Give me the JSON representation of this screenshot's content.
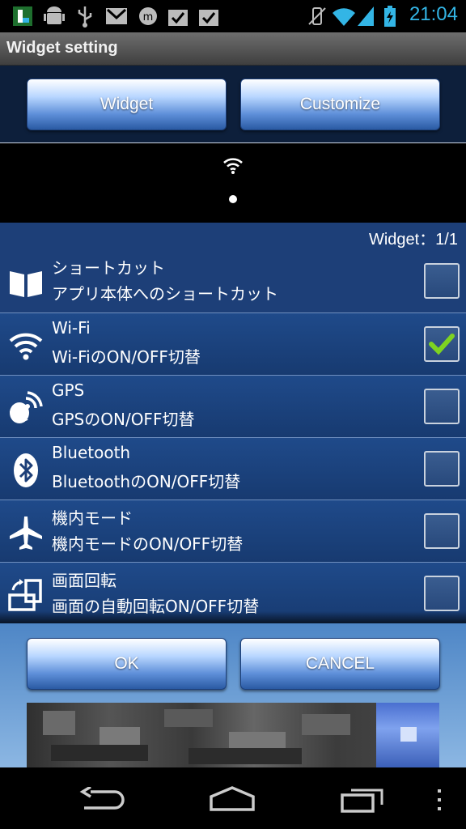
{
  "status": {
    "time": "21:04"
  },
  "title": "Widget setting",
  "tabs": {
    "widget": "Widget",
    "customize": "Customize"
  },
  "counter": "Widget：1/1",
  "items": [
    {
      "title": "ショートカット",
      "subtitle": "アプリ本体へのショートカット",
      "icon": "shortcut-icon",
      "checked": false
    },
    {
      "title": "Wi-Fi",
      "subtitle": "Wi-FiのON/OFF切替",
      "icon": "wifi-icon",
      "checked": true
    },
    {
      "title": "GPS",
      "subtitle": "GPSのON/OFF切替",
      "icon": "gps-icon",
      "checked": false
    },
    {
      "title": "Bluetooth",
      "subtitle": "BluetoothのON/OFF切替",
      "icon": "bluetooth-icon",
      "checked": false
    },
    {
      "title": "機内モード",
      "subtitle": "機内モードのON/OFF切替",
      "icon": "airplane-icon",
      "checked": false
    },
    {
      "title": "画面回転",
      "subtitle": "画面の自動回転ON/OFF切替",
      "icon": "rotate-icon",
      "checked": false
    }
  ],
  "buttons": {
    "ok": "OK",
    "cancel": "CANCEL"
  },
  "colors": {
    "accent": "#33b5e5",
    "list_bg": "#1d3f78",
    "check": "#7ed321"
  }
}
